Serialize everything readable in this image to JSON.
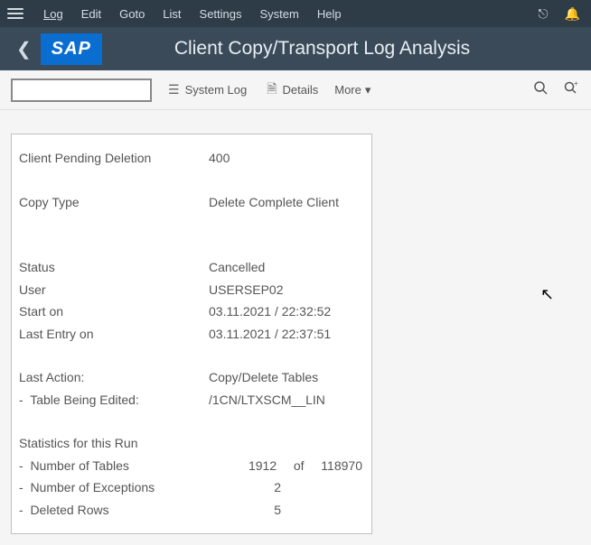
{
  "menu": {
    "items": [
      "Log",
      "Edit",
      "Goto",
      "List",
      "Settings",
      "System",
      "Help"
    ]
  },
  "header": {
    "logo": "SAP",
    "title": "Client Copy/Transport Log Analysis"
  },
  "toolbar": {
    "input_value": "",
    "system_log": "System Log",
    "details": "Details",
    "more": "More"
  },
  "panel": {
    "client_pending_label": "Client Pending Deletion",
    "client_pending_value": "400",
    "copy_type_label": "Copy Type",
    "copy_type_value": "Delete Complete Client",
    "status_label": "Status",
    "status_value": "Cancelled",
    "user_label": "User",
    "user_value": "USERSEP02",
    "start_label": "Start on",
    "start_value": "03.11.2021 / 22:32:52",
    "last_entry_label": "Last Entry on",
    "last_entry_value": "03.11.2021 / 22:37:51",
    "last_action_label": "Last Action:",
    "last_action_value": "Copy/Delete Tables",
    "table_edited_label": "-  Table Being Edited:",
    "table_edited_value": "/1CN/LTXSCM__LIN",
    "stats_heading": "Statistics for this Run",
    "num_tables_label": "-  Number of Tables",
    "num_tables_val1": "1912",
    "num_tables_of": "of",
    "num_tables_val2": "118970",
    "num_exceptions_label": "-  Number of Exceptions",
    "num_exceptions_val": "2",
    "deleted_rows_label": "-  Deleted Rows",
    "deleted_rows_val": "5"
  }
}
